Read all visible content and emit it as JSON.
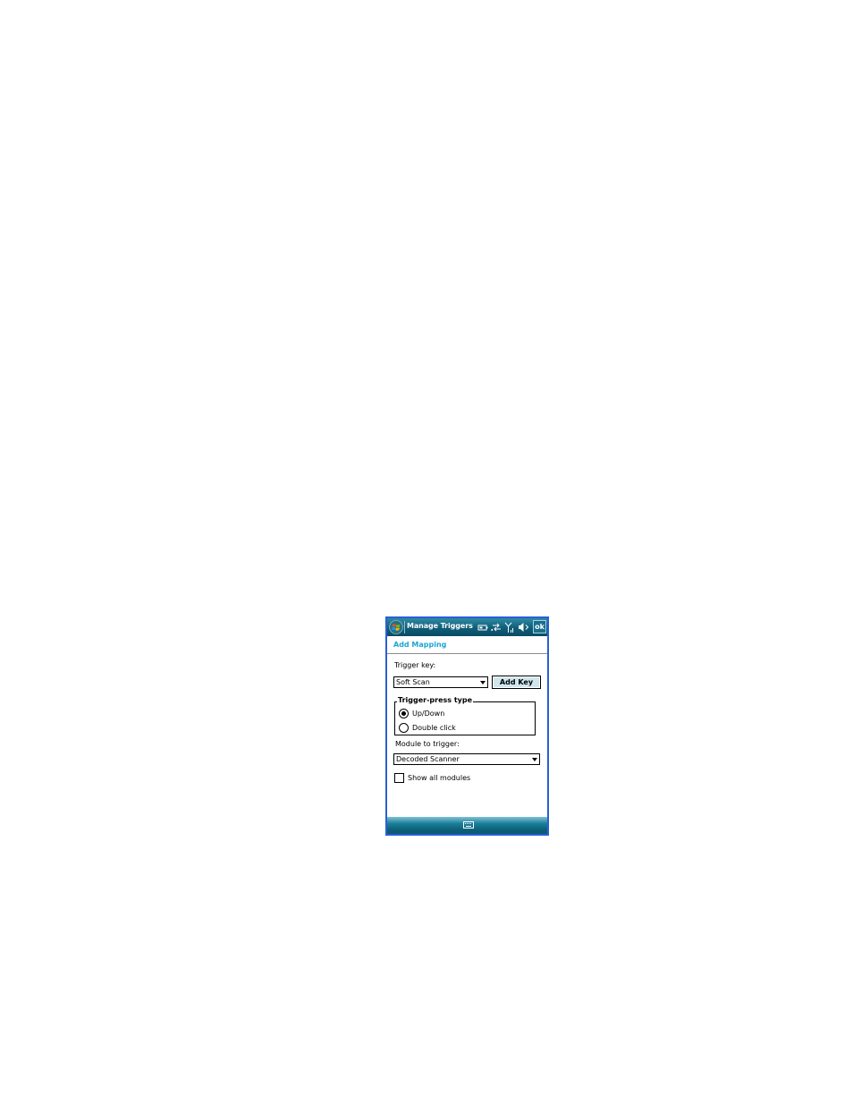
{
  "titlebar": {
    "title": "Manage Triggers",
    "ok_label": "ok",
    "status_icons": [
      "battery-icon",
      "connectivity-icon",
      "signal-icon",
      "volume-icon"
    ]
  },
  "header": {
    "section_title": "Add Mapping"
  },
  "form": {
    "trigger_key_label": "Trigger key:",
    "trigger_key_value": "Soft Scan",
    "add_key_label": "Add Key",
    "press_type_legend": "Trigger-press type",
    "press_types": [
      {
        "label": "Up/Down",
        "checked": true
      },
      {
        "label": "Double click",
        "checked": false
      }
    ],
    "module_label": "Module to trigger:",
    "module_value": "Decoded Scanner",
    "show_all_label": "Show all modules",
    "show_all_checked": false
  },
  "menubar": {
    "center_icon": "keyboard-icon"
  },
  "colors": {
    "titlebar": "#0f5d78",
    "section_title": "#1ba6d2",
    "device_border": "#2a5fd6",
    "button_face": "#cfe6ef"
  }
}
